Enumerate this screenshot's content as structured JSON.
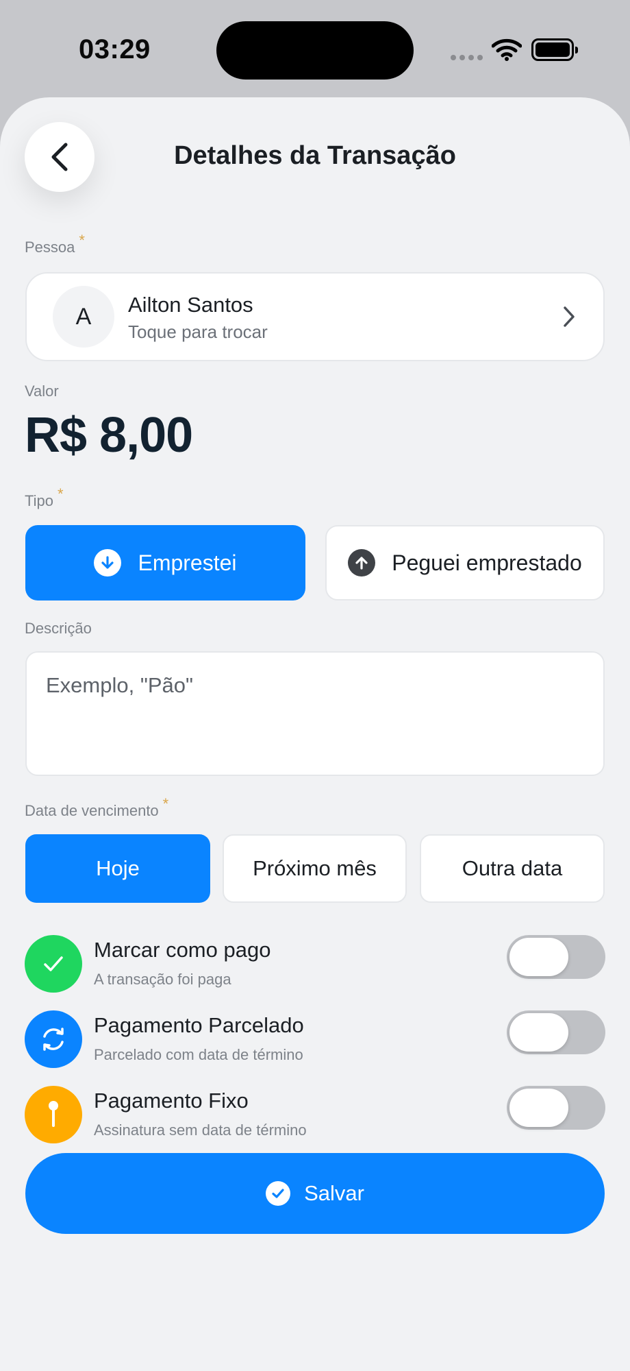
{
  "status_bar": {
    "time": "03:29"
  },
  "header": {
    "title": "Detalhes da Transação"
  },
  "person": {
    "label": "Pessoa",
    "required_mark": "*",
    "avatar_initial": "A",
    "name": "Ailton Santos",
    "subtitle": "Toque para trocar"
  },
  "value": {
    "label": "Valor",
    "amount": "R$ 8,00"
  },
  "type": {
    "label": "Tipo",
    "required_mark": "*",
    "options": [
      {
        "label": "Emprestei",
        "icon": "arrow-down-circle-icon",
        "selected": true
      },
      {
        "label": "Peguei emprestado",
        "icon": "arrow-up-circle-icon",
        "selected": false
      }
    ]
  },
  "description": {
    "label": "Descrição",
    "placeholder": "Exemplo, \"Pão\"",
    "value": ""
  },
  "due_date": {
    "label": "Data de vencimento",
    "required_mark": "*",
    "options": [
      {
        "label": "Hoje",
        "selected": true
      },
      {
        "label": "Próximo mês",
        "selected": false
      },
      {
        "label": "Outra data",
        "selected": false
      }
    ]
  },
  "options": [
    {
      "title": "Marcar como pago",
      "subtitle": "A transação foi paga",
      "icon": "check-icon",
      "color": "#1fd65f",
      "enabled": false
    },
    {
      "title": "Pagamento Parcelado",
      "subtitle": "Parcelado com data de término",
      "icon": "repeat-icon",
      "color": "#0a84ff",
      "enabled": false
    },
    {
      "title": "Pagamento Fixo",
      "subtitle": "Assinatura sem data de término",
      "icon": "pin-icon",
      "color": "#ffab00",
      "enabled": false
    }
  ],
  "save": {
    "label": "Salvar",
    "icon": "check-circle-icon"
  },
  "colors": {
    "accent": "#0a84ff",
    "background": "#f1f2f4",
    "required": "#d9a64b"
  }
}
